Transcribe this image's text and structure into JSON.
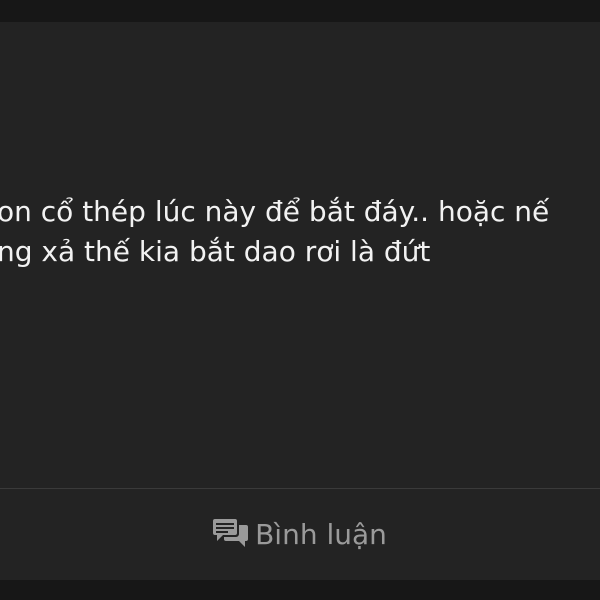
{
  "post": {
    "lines": [
      "on cổ thép lúc này để bắt đáy.. hoặc nế",
      "ng xả thế kia bắt dao rơi là đứt"
    ]
  },
  "actions": {
    "comment_label": "Bình luận",
    "comment_icon": "comment-bubbles-icon"
  },
  "colors": {
    "background": "#171717",
    "card": "#232323",
    "text": "#f2f2f2",
    "muted": "#9a9a9a",
    "divider": "#3a3a3a"
  }
}
